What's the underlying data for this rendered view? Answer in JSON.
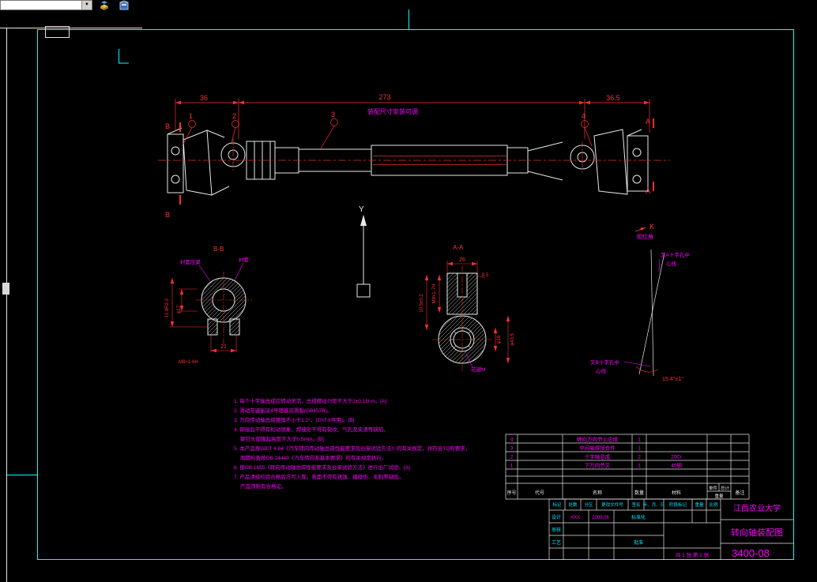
{
  "toolbar": {
    "combo_value": "",
    "dropdown_glyph": "▼"
  },
  "dims": {
    "left": "36",
    "center": "273",
    "right": "36.5",
    "adjust_note": "装配尺寸安装可调"
  },
  "balloons": {
    "b1": "1",
    "b2": "2",
    "b3": "3",
    "b4": "4"
  },
  "marks": {
    "b_top": "B",
    "b_bot": "B",
    "a_top": "A",
    "a_bot": "A",
    "k": "K",
    "phase": "相位角",
    "y_axis": "Y"
  },
  "section_bb": {
    "title": "B-B",
    "label_left": "衬套压紧",
    "label_right": "衬套",
    "dia": "φ17",
    "depth": "11.8R2.2",
    "thread": "M8×1-6H",
    "width": "21"
  },
  "section_aa": {
    "title": "A-A",
    "w26": "26",
    "w85": "8.5",
    "h105": "10.5±0.2",
    "thread": "M8×1-7H",
    "dia16": "φ16",
    "dia43": "φ43.5",
    "spline": "花键M"
  },
  "view_k": {
    "fork_a1": "叉A十字孔中",
    "fork_a2": "心线",
    "fork_b1": "叉B十字孔中",
    "fork_b2": "心线",
    "angle": "15.4°±1°"
  },
  "notes": {
    "l1": "1. 每个十字轴总成应转动灵活，总成摆动力矩不大于2±0.1N·m。[A]",
    "l2": "2. 滑动花键副涂4号锂基润滑脂(GB457B)。",
    "l3": "3. 万向传动轴总成摆角不小于1.2°，(1H7.8件用)。[B]",
    "l4a": "4. 铆接后不得有松动现象，焊缝处不得有裂纹、气孔及夹渣等缺陷，",
    "l4b": "铆钉头部隆起高度不大于0.5mm。[B]",
    "l5a": "5. 本产品按GB/T 4.84《汽车转向传动轴总成性能要求及台架试验方法》的有关规定，并符合TQ的要求，",
    "l5b": "周期检查按GB 24449《汽车转向系基本要求》的有关规定执行。",
    "l6": "6. 按GB 1655《转向传动轴总成性能要求及台架试验方法》进行出厂试验。[A]",
    "l7a": "7. 产品须经检验合格后方可入库，表面不得有锈蚀、磕碰伤、毛刺等缺陷，",
    "l7b": "产品须附有合格证。"
  },
  "parts": {
    "rows": [
      {
        "no": "4",
        "name": "转向万向节上总成",
        "qty": "1",
        "mat": ""
      },
      {
        "no": "3",
        "name": "中间轴焊接合件",
        "qty": "1",
        "mat": ""
      },
      {
        "no": "2",
        "name": "十字轴总成",
        "qty": "2",
        "mat": "20Cr"
      },
      {
        "no": "1",
        "name": "下万向节叉",
        "qty": "1",
        "mat": "45钢"
      }
    ],
    "headers": {
      "no": "序号",
      "code": "代号",
      "name": "名称",
      "qty": "数量",
      "mat": "材料",
      "unit": "单件",
      "total": "总计",
      "weight": "重量",
      "remark": "备注"
    }
  },
  "titleblock": {
    "school": "江西农业大学",
    "drawing_title": "转向轴装配图",
    "drawing_no": "3400-08",
    "sheet": "共 1 张 第 1 张",
    "stage": "阶段标记",
    "weight": "重量",
    "scale": "比例",
    "rev": {
      "mark": "标记",
      "count": "处数",
      "zone": "分区",
      "doc": "更改文件号",
      "sign": "签名",
      "date": "年、月、日"
    },
    "roles": {
      "design": "设计",
      "check": "审核",
      "process": "工艺",
      "approve": "批准",
      "standard": "标准化"
    },
    "design_sign": "XXX",
    "design_date": "2009.06"
  }
}
